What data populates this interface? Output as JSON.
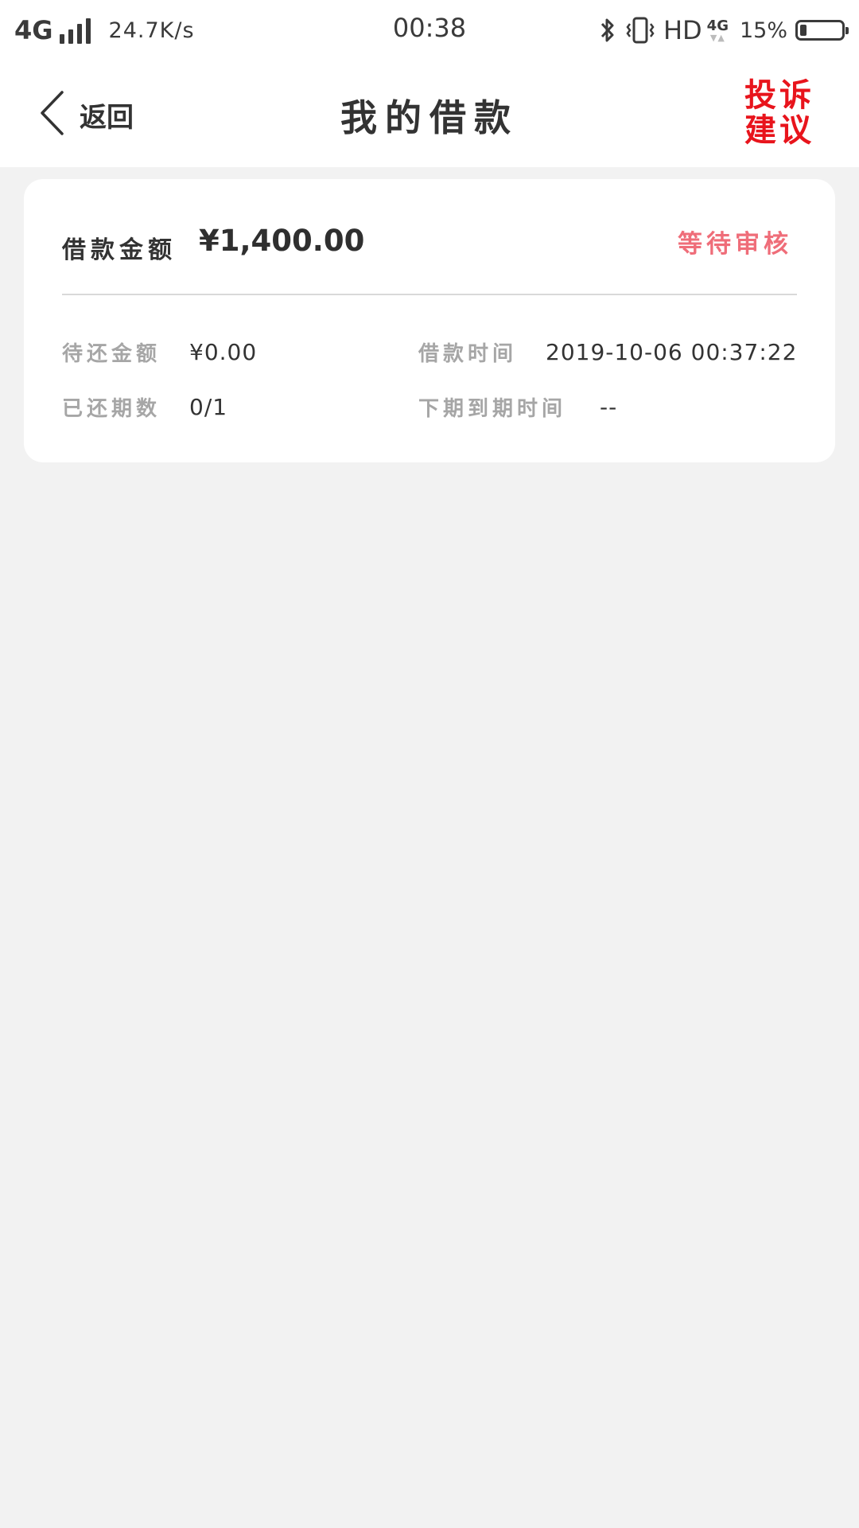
{
  "status_bar": {
    "network": "4G",
    "speed": "24.7K/s",
    "time": "00:38",
    "hd": "HD",
    "network_small": "4G",
    "battery_percent": "15%",
    "battery_level": 0.15
  },
  "nav": {
    "back_label": "返回",
    "title": "我的借款",
    "complaint_line1": "投诉",
    "complaint_line2": "建议",
    "complaint_color": "#e8141c"
  },
  "loan": {
    "amount_label": "借款金额",
    "amount_value": "¥1,400.00",
    "status": "等待审核",
    "status_color": "#ef6d79",
    "pending_label": "待还金额",
    "pending_value": "¥0.00",
    "time_label": "借款时间",
    "time_value": "2019-10-06 00:37:22",
    "periods_label": "已还期数",
    "periods_value": "0/1",
    "next_due_label": "下期到期时间",
    "next_due_value": "--"
  }
}
